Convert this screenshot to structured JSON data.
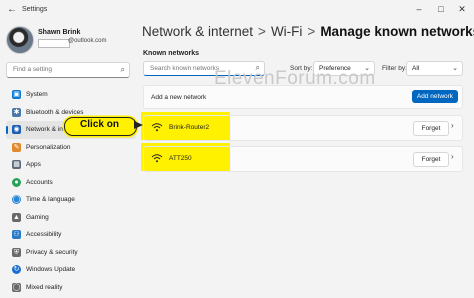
{
  "window": {
    "title": "Settings",
    "back_icon": "back-arrow-icon",
    "controls": [
      "minimize",
      "maximize",
      "close"
    ]
  },
  "profile": {
    "name": "Shawn Brink",
    "email": "@outlook.com"
  },
  "find_setting": {
    "placeholder": "Find a setting"
  },
  "sidebar": {
    "items": [
      {
        "label": "System",
        "icon": "system-icon",
        "color": "#0a7ad6"
      },
      {
        "label": "Bluetooth & devices",
        "icon": "bluetooth-icon",
        "color": "#4a78a8"
      },
      {
        "label": "Network & internet",
        "icon": "wifi-icon",
        "color": "#1a5fb4",
        "active": true
      },
      {
        "label": "Personalization",
        "icon": "brush-icon",
        "color": "#e08a2a"
      },
      {
        "label": "Apps",
        "icon": "apps-icon",
        "color": "#5a6a7a"
      },
      {
        "label": "Accounts",
        "icon": "accounts-icon",
        "color": "#2aa05a"
      },
      {
        "label": "Time & language",
        "icon": "globe-icon",
        "color": "#2b86d6"
      },
      {
        "label": "Gaming",
        "icon": "gaming-icon",
        "color": "#6a6a6a"
      },
      {
        "label": "Accessibility",
        "icon": "accessibility-icon",
        "color": "#2a7ac8"
      },
      {
        "label": "Privacy & security",
        "icon": "shield-icon",
        "color": "#6a6a6a"
      },
      {
        "label": "Windows Update",
        "icon": "update-icon",
        "color": "#1a6fd0"
      },
      {
        "label": "Mixed reality",
        "icon": "mixed-reality-icon",
        "color": "#6a6a6a"
      }
    ]
  },
  "breadcrumb": {
    "items": [
      "Network & internet",
      "Wi-Fi"
    ],
    "separator": ">",
    "current": "Manage known networks"
  },
  "known_networks": {
    "heading": "Known networks",
    "search_placeholder": "Search known networks",
    "sort_label": "Sort by:",
    "sort_value": "Preference",
    "filter_label": "Filter by:",
    "filter_value": "All",
    "add_label": "Add a new network",
    "add_button": "Add network",
    "networks": [
      {
        "name": "Brink-Router2",
        "forget": "Forget"
      },
      {
        "name": "ATT250",
        "forget": "Forget"
      }
    ]
  },
  "callout": {
    "text": "Click on"
  },
  "watermark": "ElevenForum.com",
  "colors": {
    "accent": "#0067c0",
    "highlight": "#fff100",
    "background": "#f3f3f3"
  }
}
